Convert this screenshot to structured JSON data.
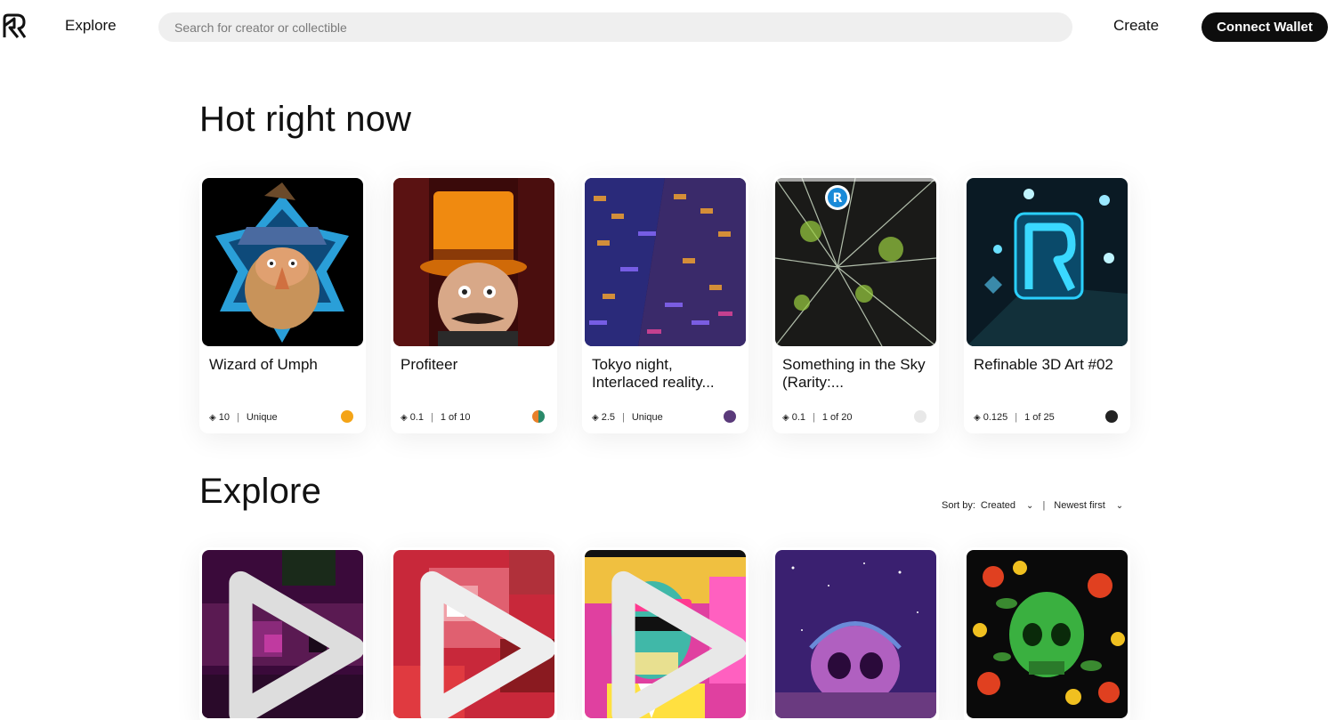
{
  "header": {
    "logo_icon": "refinable-logo-icon",
    "explore_label": "Explore",
    "search_placeholder": "Search for creator or collectible",
    "create_label": "Create",
    "connect_label": "Connect Wallet"
  },
  "hot": {
    "title": "Hot right now",
    "cards": [
      {
        "name": "Wizard of Umph",
        "price": "10",
        "edition": "Unique",
        "owner_color": "#f4a417"
      },
      {
        "name": "Profiteer",
        "price": "0.1",
        "edition": "1 of 10",
        "owner_color": "#2a8a6a"
      },
      {
        "name": "Tokyo night, Interlaced reality...",
        "price": "2.5",
        "edition": "Unique",
        "owner_color": "#5a3a7a"
      },
      {
        "name": "Something in the Sky (Rarity:...",
        "price": "0.1",
        "edition": "1 of 20",
        "owner_color": "#bbbbbb"
      },
      {
        "name": "Refinable 3D Art #02",
        "price": "0.125",
        "edition": "1 of 25",
        "owner_color": "#222222"
      }
    ]
  },
  "explore": {
    "title": "Explore",
    "sort_label": "Sort by:",
    "sort_value": "Created",
    "order_value": "Newest first",
    "chevron": "⌄",
    "pipe": "|",
    "cards": [
      {
        "kind": "video"
      },
      {
        "kind": "video"
      },
      {
        "kind": "video"
      },
      {
        "kind": "image"
      },
      {
        "kind": "image"
      }
    ]
  },
  "icons": {
    "price_icon": "ethereum-diamond-icon",
    "play_icon": "play-icon",
    "diamond_glyph": "◈",
    "separator": "|"
  }
}
